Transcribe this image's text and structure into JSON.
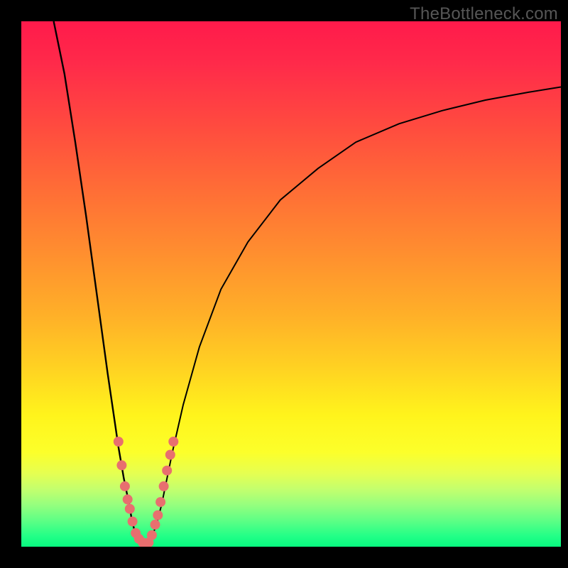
{
  "watermark": "TheBottleneck.com",
  "colors": {
    "frame": "#000000",
    "curve": "#000000",
    "marker": "#e86f6f",
    "gradient_top": "#ff1a4b",
    "gradient_bottom": "#08f97f"
  },
  "chart_data": {
    "type": "line",
    "title": "",
    "xlabel": "",
    "ylabel": "",
    "xlim": [
      0,
      100
    ],
    "ylim": [
      0,
      100
    ],
    "grid": false,
    "legend": false,
    "note": "Axes are implicit (no ticks/labels). x≈parameter position left→right across plot, y≈bottleneck % (0 at bottom=green/good, 100 at top=red/bad). Values estimated from pixel positions.",
    "series": [
      {
        "name": "left_curve",
        "x": [
          6,
          8,
          10,
          12,
          14,
          16,
          17,
          18,
          19,
          20,
          20.5,
          21,
          22,
          22.5,
          23
        ],
        "y": [
          100,
          90,
          77,
          63,
          48,
          33,
          26,
          19,
          13,
          8,
          5,
          3,
          1.5,
          0.8,
          0.3
        ]
      },
      {
        "name": "right_curve",
        "x": [
          23,
          24,
          25,
          26,
          27,
          28,
          30,
          33,
          37,
          42,
          48,
          55,
          62,
          70,
          78,
          86,
          94,
          100
        ],
        "y": [
          0.3,
          1.5,
          4,
          8,
          13,
          18,
          27,
          38,
          49,
          58,
          66,
          72,
          77,
          80.5,
          83,
          85,
          86.5,
          87.5
        ]
      }
    ],
    "markers": {
      "name": "highlighted_points",
      "note": "Salmon dots clustered near the minimum of the V-shape.",
      "points": [
        {
          "x": 18.0,
          "y": 20.0
        },
        {
          "x": 18.6,
          "y": 15.5
        },
        {
          "x": 19.2,
          "y": 11.5
        },
        {
          "x": 19.7,
          "y": 9.0
        },
        {
          "x": 20.1,
          "y": 7.2
        },
        {
          "x": 20.6,
          "y": 4.8
        },
        {
          "x": 21.2,
          "y": 2.6
        },
        {
          "x": 21.8,
          "y": 1.5
        },
        {
          "x": 22.5,
          "y": 0.8
        },
        {
          "x": 23.0,
          "y": 0.4
        },
        {
          "x": 23.6,
          "y": 0.8
        },
        {
          "x": 24.2,
          "y": 2.2
        },
        {
          "x": 24.8,
          "y": 4.2
        },
        {
          "x": 25.3,
          "y": 6.0
        },
        {
          "x": 25.8,
          "y": 8.5
        },
        {
          "x": 26.4,
          "y": 11.5
        },
        {
          "x": 27.0,
          "y": 14.5
        },
        {
          "x": 27.6,
          "y": 17.5
        },
        {
          "x": 28.2,
          "y": 20.0
        }
      ]
    }
  }
}
